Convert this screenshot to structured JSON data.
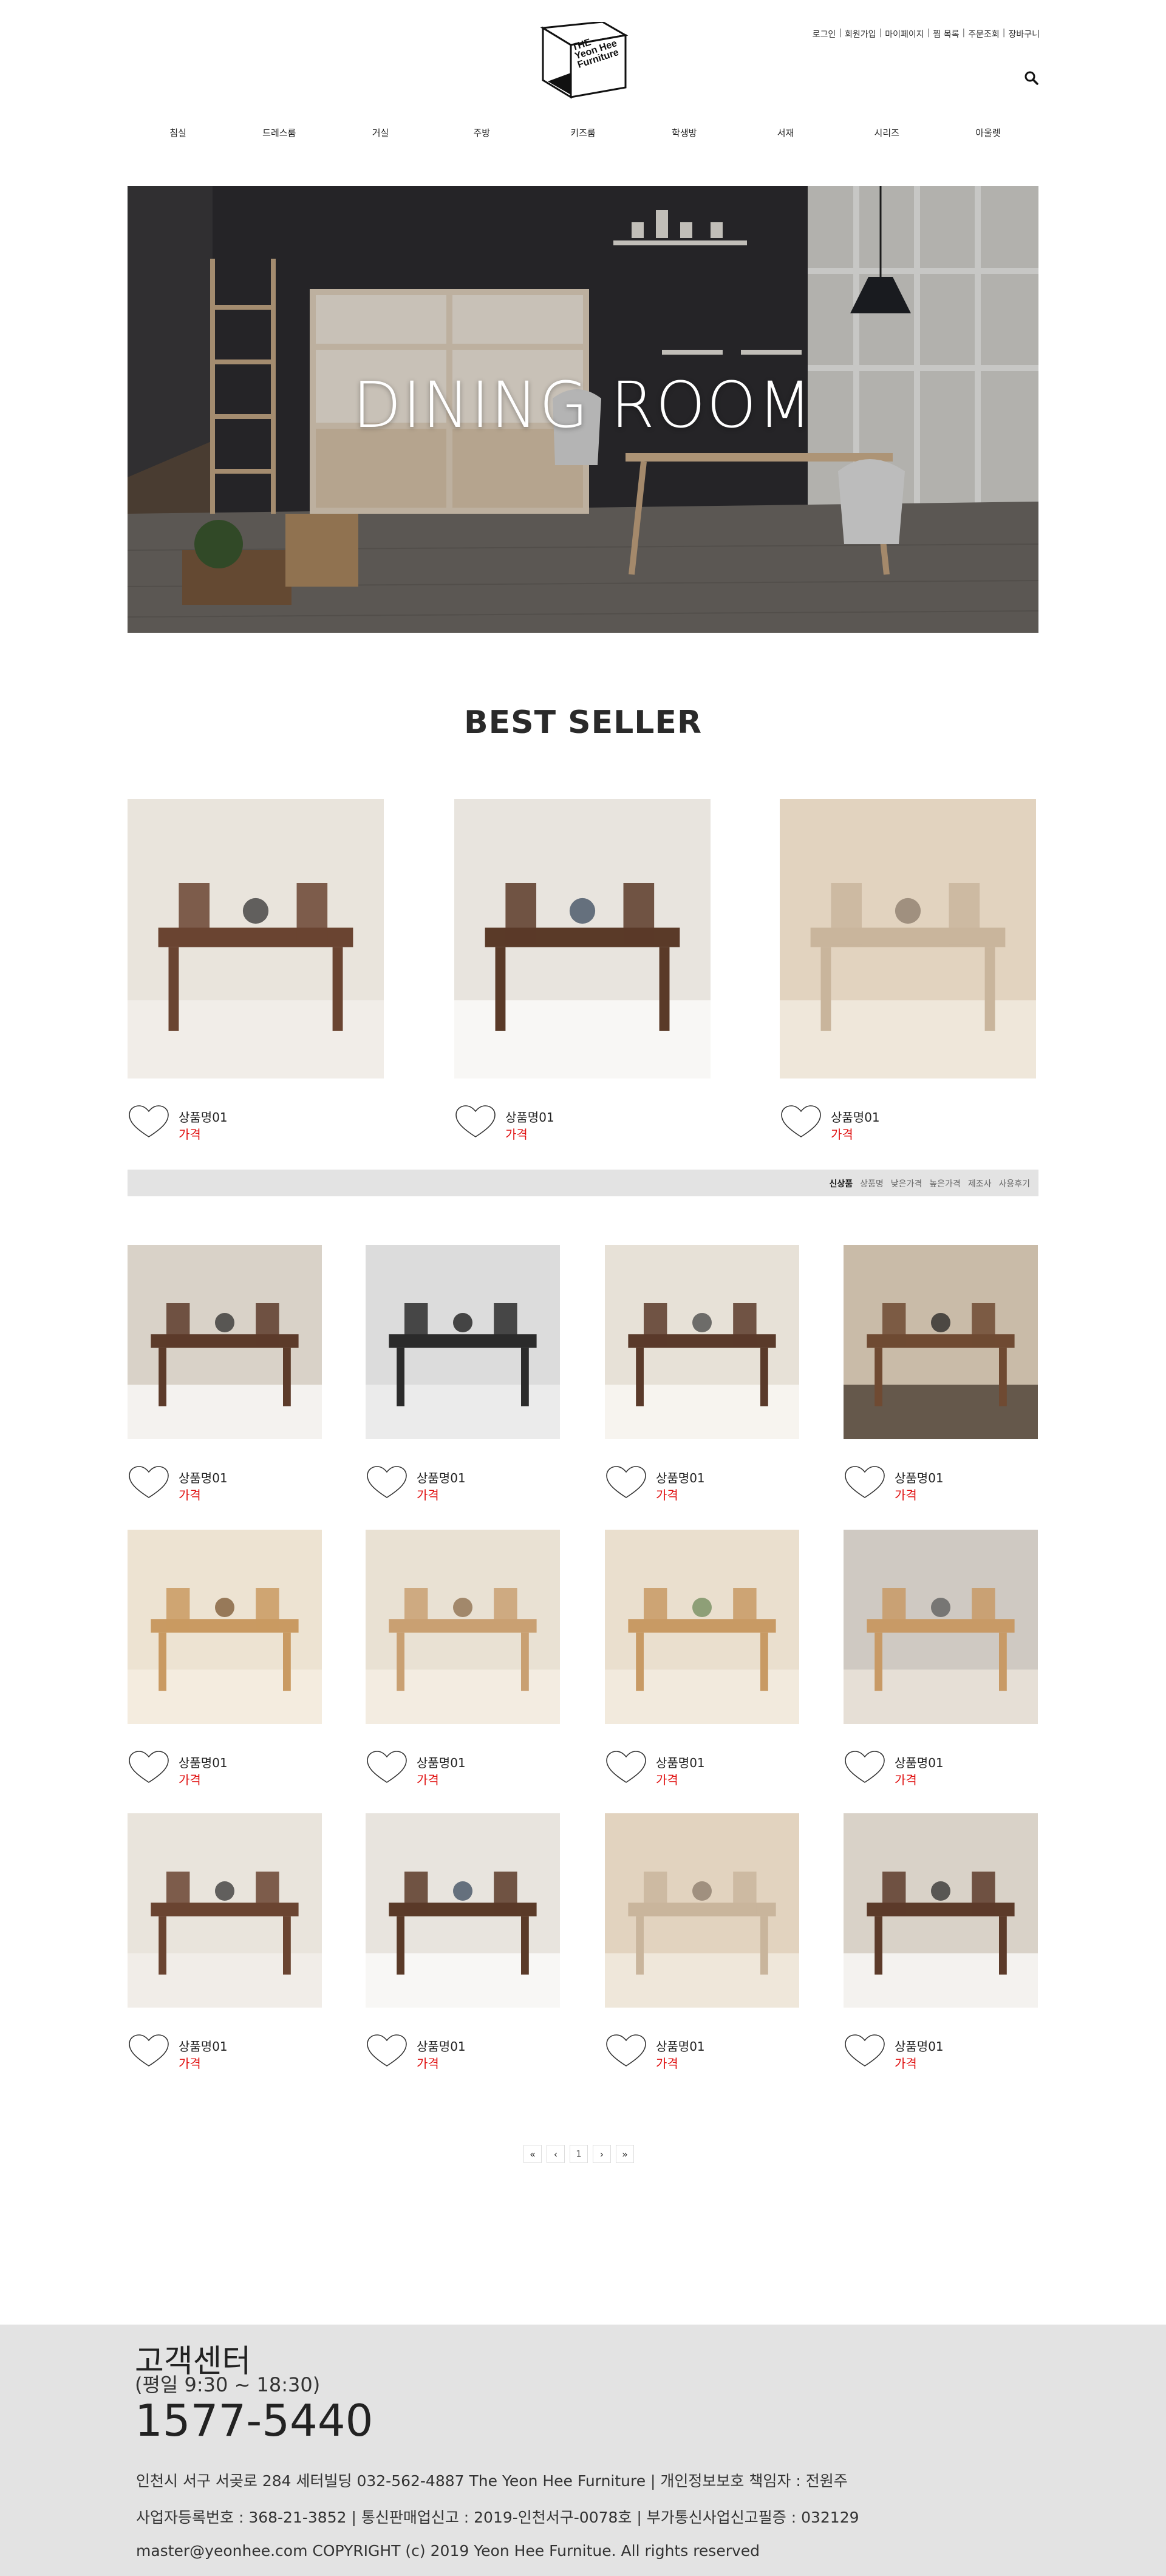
{
  "header": {
    "logo_lines": [
      "THE",
      "Yeon Hee",
      "Furniture"
    ],
    "util_links": [
      "로그인",
      "회원가입",
      "마이페이지",
      "찜 목록",
      "주문조회",
      "장바구니"
    ]
  },
  "nav": {
    "items": [
      "침실",
      "드레스룸",
      "거실",
      "주방",
      "키즈룸",
      "학생방",
      "서재",
      "시리즈",
      "아울렛"
    ]
  },
  "hero": {
    "title": "DINING ROOM"
  },
  "best_seller": {
    "title": "BEST SELLER",
    "items": [
      {
        "name": "상품명01",
        "price": "가격"
      },
      {
        "name": "상품명01",
        "price": "가격"
      },
      {
        "name": "상품명01",
        "price": "가격"
      }
    ]
  },
  "sort": {
    "options": [
      "신상품",
      "상품명",
      "낮은가격",
      "높은가격",
      "제조사",
      "사용후기"
    ],
    "active": "신상품"
  },
  "products": {
    "items": [
      {
        "name": "상품명01",
        "price": "가격"
      },
      {
        "name": "상품명01",
        "price": "가격"
      },
      {
        "name": "상품명01",
        "price": "가격"
      },
      {
        "name": "상품명01",
        "price": "가격"
      },
      {
        "name": "상품명01",
        "price": "가격"
      },
      {
        "name": "상품명01",
        "price": "가격"
      },
      {
        "name": "상품명01",
        "price": "가격"
      },
      {
        "name": "상품명01",
        "price": "가격"
      },
      {
        "name": "상품명01",
        "price": "가격"
      },
      {
        "name": "상품명01",
        "price": "가격"
      },
      {
        "name": "상품명01",
        "price": "가격"
      },
      {
        "name": "상품명01",
        "price": "가격"
      }
    ]
  },
  "pagination": {
    "first": "«",
    "prev": "‹",
    "current": "1",
    "next": "›",
    "last": "»"
  },
  "footer": {
    "cs_title": "고객센터",
    "hours": "(평일 9:30 ~ 18:30)",
    "phone": "1577-5440",
    "address_line": "인천시 서구 서곶로 284 세터빌딩 032-562-4887 The Yeon Hee Furniture  |  개인정보보호 책임자 : 전원주",
    "biz_line": "사업자등록번호 : 368-21-3852  |  통신판매업신고 : 2019-인천서구-0078호  |  부가통신사업신고필증 : 032129",
    "copyright": "master@yeonhee.com COPYRIGHT (c) 2019 Yeon Hee Furnitue. All rights reserved"
  },
  "colors": {
    "price": "#e01010",
    "footer_bg": "#e3e3e3",
    "sortbar_bg": "#e3e3e3",
    "text": "#222222"
  }
}
